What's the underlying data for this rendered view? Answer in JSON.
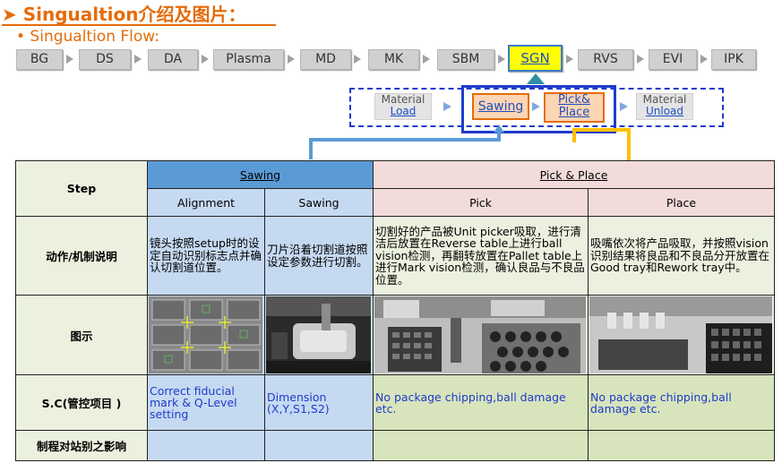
{
  "header": {
    "title": "➤ Singualtion介绍及图片：",
    "subtitle": "• Singualtion Flow:"
  },
  "flow": {
    "steps": [
      "BG",
      "DS",
      "DA",
      "Plasma",
      "MD",
      "MK",
      "SBM",
      "SGN",
      "RVS",
      "EVI",
      "IPK"
    ],
    "active": "SGN"
  },
  "subflow": {
    "material_load_1": "Material",
    "material_load_2": "Load",
    "sawing": "Sawing",
    "pick_place_1": "Pick&",
    "pick_place_2": "Place",
    "material_unload_1": "Material",
    "material_unload_2": "Unload"
  },
  "table": {
    "step_label": "Step",
    "sawing_header": "Sawing",
    "pickplace_header": "Pick & Place",
    "sub_alignment": "Alignment",
    "sub_sawing": "Sawing",
    "sub_pick": "Pick",
    "sub_place": "Place",
    "row_action_label": "动作/机制说明",
    "action_alignment": "镜头按照setup时的设定自动识别标志点并确认切割道位置。",
    "action_sawing": "刀片沿着切割道按照设定参数进行切割。",
    "action_pick": "切割好的产品被Unit picker吸取，进行清洁后放置在Reverse table上进行ball vision检测，再翻转放置在Pallet table上进行Mark vision检测，确认良品与不良品位置。",
    "action_place": "吸嘴依次将产品吸取，并按照vision识别结果将良品和不良品分开放置在Good tray和Rework tray中。",
    "row_image_label": "图示",
    "row_sc_label": "S.C(管控项目 )",
    "sc_alignment": "Correct fiducial mark & Q-Level setting",
    "sc_sawing": "Dimension (X,Y,S1,S2)",
    "sc_pick": " No package chipping,ball damage etc.",
    "sc_place": " No package chipping,ball damage etc.",
    "row_impact_label": "制程对站别之影响"
  },
  "colors": {
    "accent": "#e46c0a",
    "sawing_header": "#5b9bd5",
    "sawing_cell": "#c5d9f1",
    "pick_header": "#f2dcdb",
    "green_cell": "#ebf1de",
    "flow_active": "#ffff00"
  }
}
